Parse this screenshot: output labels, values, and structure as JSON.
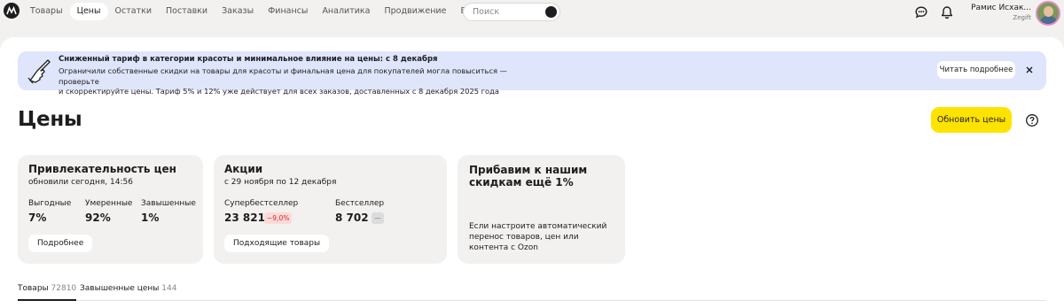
{
  "nav": {
    "items": [
      "Товары",
      "Цены",
      "Остатки",
      "Поставки",
      "Заказы",
      "Финансы",
      "Аналитика",
      "Продвижение",
      "Витрина"
    ],
    "active_index": 1,
    "search_placeholder": "Поиск"
  },
  "user": {
    "name": "Рамис Исхак...",
    "org": "Zegift"
  },
  "banner": {
    "title": "Сниженный тариф в категории красоты и минимальное влияние на цены: с 8 декабря",
    "line1": "Ограничили собственные скидки на товары для красоты и финальная цена для покупателей могла повыситься — проверьте",
    "line2": "и скорректируйте цены. Тариф 5% и 12% уже действует для всех заказов, доставленных с 8 декабря 2025 года",
    "button": "Читать подробнее"
  },
  "page": {
    "title": "Цены",
    "refresh_button": "Обновить цены"
  },
  "cards": {
    "attractiveness": {
      "title": "Привлекательность цен",
      "subtitle": "обновили сегодня, 14:56",
      "metrics": [
        {
          "label": "Выгодные",
          "value": "7%"
        },
        {
          "label": "Умеренные",
          "value": "92%"
        },
        {
          "label": "Завышенные",
          "value": "1%"
        }
      ],
      "button": "Подробнее"
    },
    "promotions": {
      "title": "Акции",
      "subtitle": "с 29 ноября по 12 декабря",
      "metrics": [
        {
          "label": "Супербестселлер",
          "value": "23 821 ₽",
          "badge": "−9,0%"
        },
        {
          "label": "Бестселлер",
          "value": "8 702 ₽",
          "badge": "—"
        }
      ],
      "button": "Подходящие товары"
    },
    "promo": {
      "title": "Прибавим к нашим скидкам ещё 1%",
      "text": "Если настроите автоматический перенос товаров, цен или контента с Ozon"
    }
  },
  "tabs": [
    {
      "label": "Товары",
      "count": "72810"
    },
    {
      "label": "Завышенные цены",
      "count": "144"
    }
  ],
  "colors": {
    "accent_yellow": "#ffe300",
    "banner_bg": "#dfe5fb",
    "card_bg": "#f2f1ef",
    "negative": "#d62d2d"
  }
}
